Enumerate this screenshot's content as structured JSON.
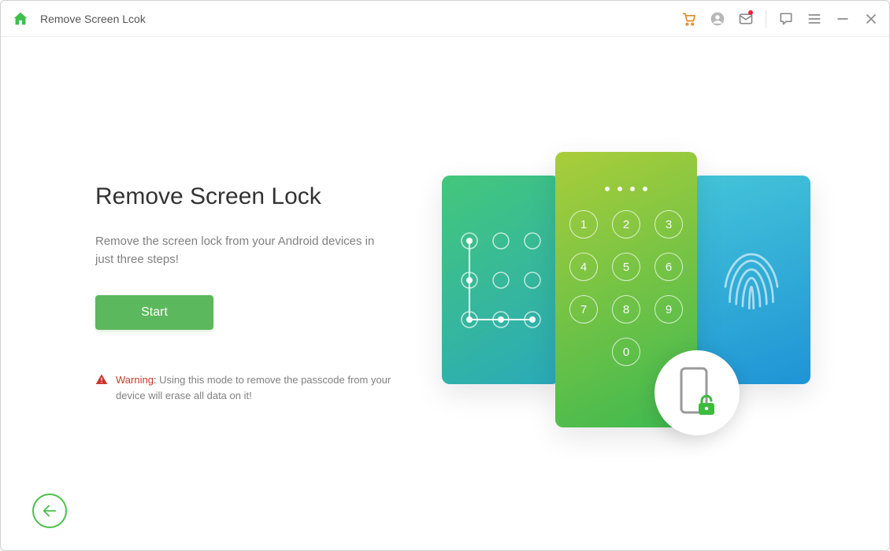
{
  "header": {
    "title": "Remove Screen Lcok"
  },
  "main": {
    "heading": "Remove Screen Lock",
    "description": "Remove the screen lock from your Android devices in just three steps!",
    "start_label": "Start",
    "warning_label": "Warning:",
    "warning_text": " Using this mode to remove the passcode from your device will erase all data on it!"
  },
  "keypad_digits": [
    "1",
    "2",
    "3",
    "4",
    "5",
    "6",
    "7",
    "8",
    "9",
    "0"
  ],
  "colors": {
    "primary_green": "#4cc04c",
    "warn_red": "#c7392b",
    "cart_orange": "#e08a2a"
  }
}
